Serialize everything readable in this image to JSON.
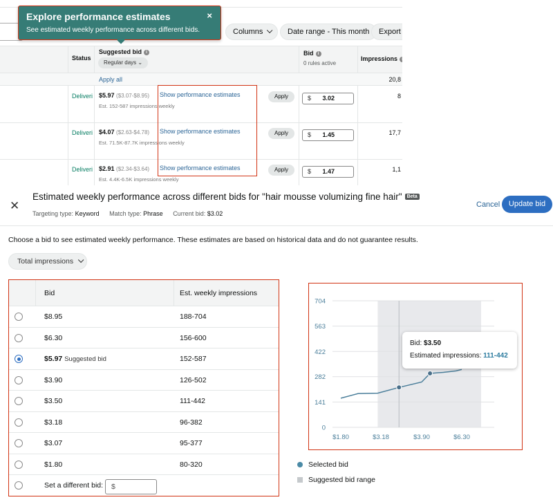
{
  "banner": {
    "title": "Explore performance estimates",
    "subtitle": "See estimated weekly performance across different bids.",
    "close": "×"
  },
  "toolbar": {
    "columns": "Columns",
    "date_range": "Date range - This month",
    "export": "Export"
  },
  "table": {
    "headers": {
      "status": "Status",
      "suggested_bid": "Suggested bid",
      "suggested_bid_filter": "Regular days",
      "bid": "Bid",
      "bid_sub": "0 rules active",
      "impressions": "Impressions"
    },
    "apply_all": "Apply all",
    "total_impressions": "20,8",
    "rows": [
      {
        "status": "Deliveri",
        "bid": "$5.97",
        "range": "($3.07-$8.95)",
        "est": "Est. 152-587 impressions weekly",
        "link": "Show performance estimates",
        "apply": "Apply",
        "currency": "$",
        "value": "3.02",
        "impressions": "8"
      },
      {
        "status": "Deliveri",
        "bid": "$4.07",
        "range": "($2.63-$4.78)",
        "est": "Est. 71.5K-87.7K impressions weekly",
        "link": "Show performance estimates",
        "apply": "Apply",
        "currency": "$",
        "value": "1.45",
        "impressions": "17,7"
      },
      {
        "status": "Deliveri",
        "bid": "$2.91",
        "range": "($2.34-$3.64)",
        "est": "Est. 4.4K-6.5K impressions weekly",
        "link": "Show performance estimates",
        "apply": "Apply",
        "currency": "$",
        "value": "1.47",
        "impressions": "1,1"
      }
    ]
  },
  "modal": {
    "close": "✕",
    "title": "Estimated weekly performance across different bids for \"hair mousse volumizing fine hair\"",
    "beta": "Beta",
    "targeting_label": "Targeting type:",
    "targeting_value": "Keyword",
    "match_label": "Match type:",
    "match_value": "Phrase",
    "current_label": "Current bid:",
    "current_value": "$3.02",
    "cancel": "Cancel",
    "update": "Update bid",
    "instructions": "Choose a bid to see estimated weekly performance. These estimates are based on historical data and do not guarantee results.",
    "metric": "Total impressions"
  },
  "bid_options": {
    "header_bid": "Bid",
    "header_impressions": "Est. weekly impressions",
    "suggested_tag": "Suggested bid",
    "rows": [
      {
        "bid": "$8.95",
        "impressions": "188-704",
        "selected": false,
        "suggested": false
      },
      {
        "bid": "$6.30",
        "impressions": "156-600",
        "selected": false,
        "suggested": false
      },
      {
        "bid": "$5.97",
        "impressions": "152-587",
        "selected": true,
        "suggested": true
      },
      {
        "bid": "$3.90",
        "impressions": "126-502",
        "selected": false,
        "suggested": false
      },
      {
        "bid": "$3.50",
        "impressions": "111-442",
        "selected": false,
        "suggested": false
      },
      {
        "bid": "$3.18",
        "impressions": "96-382",
        "selected": false,
        "suggested": false
      },
      {
        "bid": "$3.07",
        "impressions": "95-377",
        "selected": false,
        "suggested": false
      },
      {
        "bid": "$1.80",
        "impressions": "80-320",
        "selected": false,
        "suggested": false
      }
    ],
    "custom_label": "Set a different bid:",
    "custom_placeholder": "$"
  },
  "chart_data": {
    "type": "line",
    "y_ticks": [
      0,
      141,
      282,
      422,
      563,
      704
    ],
    "x_tick_labels": [
      "$1.80",
      "$3.18",
      "$3.90",
      "$6.30"
    ],
    "ylim": [
      0,
      704
    ],
    "points": [
      {
        "bid": 1.8,
        "impressions": 162
      },
      {
        "bid": 2.4,
        "impressions": 188
      },
      {
        "bid": 3.07,
        "impressions": 190
      },
      {
        "bid": 3.5,
        "impressions": 222
      },
      {
        "bid": 3.9,
        "impressions": 252
      },
      {
        "bid": 4.4,
        "impressions": 300
      },
      {
        "bid": 5.2,
        "impressions": 306
      },
      {
        "bid": 5.97,
        "impressions": 314
      },
      {
        "bid": 6.3,
        "impressions": 322
      }
    ],
    "marked_points": [
      3.5,
      4.4
    ],
    "suggested_range": [
      3.07,
      8.95
    ],
    "hover_bid": 3.5,
    "grid": true,
    "colors": {
      "line": "#4a7e9a",
      "band": "#e8e9ec",
      "dot": "#4a6f8a"
    },
    "tooltip": {
      "bid_label": "Bid:",
      "bid_value": "$3.50",
      "impr_label": "Estimated impressions:",
      "impr_value": "111-442"
    },
    "legend": [
      {
        "label": "Selected bid",
        "marker": "dot"
      },
      {
        "label": "Suggested bid range",
        "marker": "square"
      }
    ]
  }
}
